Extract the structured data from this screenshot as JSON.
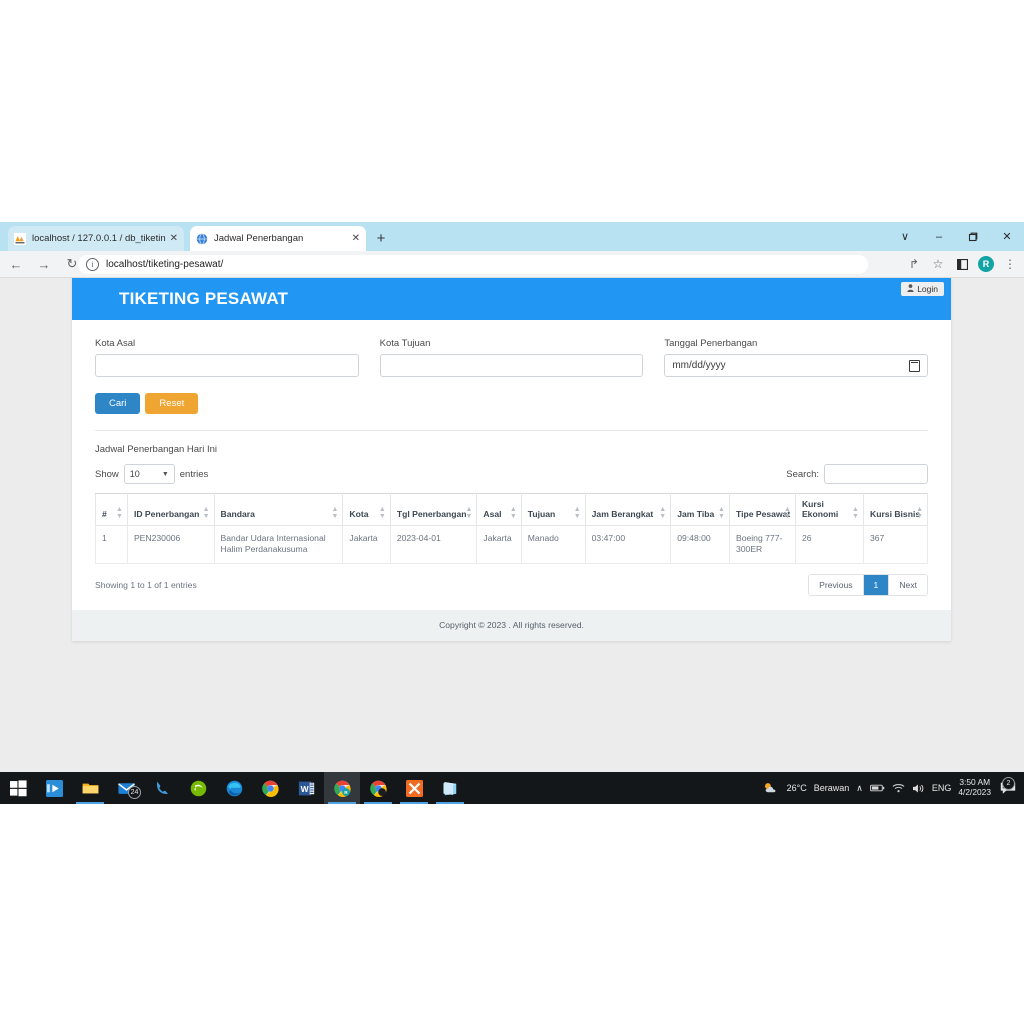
{
  "browser": {
    "tabs": [
      {
        "title": "localhost / 127.0.0.1 / db_tiketing",
        "favicon": "phpmyadmin-icon",
        "close": "✕",
        "active": false
      },
      {
        "title": "Jadwal Penerbangan",
        "favicon": "globe-icon",
        "close": "✕",
        "active": true
      }
    ],
    "new_tab_label": "+",
    "window_controls": {
      "collapse": "∨",
      "minimize": "–",
      "maximize": "❐",
      "close": "✕"
    },
    "nav": {
      "back": "←",
      "forward": "→",
      "reload": "↻"
    },
    "omnibox": {
      "info": "i",
      "url": "localhost/tiketing-pesawat/"
    },
    "toolbar_icons": {
      "share": "↱",
      "bookmark": "☆",
      "sidepanel": "◨",
      "menu": "⋮"
    },
    "profile_initial": "R"
  },
  "site": {
    "brand": "TIKETING PESAWAT",
    "login_label": "Login",
    "login_icon": "user-icon",
    "accent_blue": "#2196f3",
    "button_blue": "#2e86c7",
    "button_orange": "#efa531"
  },
  "search_form": {
    "fields": [
      {
        "label": "Kota Asal",
        "value": "",
        "type": "text"
      },
      {
        "label": "Kota Tujuan",
        "value": "",
        "type": "text"
      },
      {
        "label": "Tanggal Penerbangan",
        "value": "mm/dd/yyyy",
        "type": "date"
      }
    ],
    "submit_label": "Cari",
    "reset_label": "Reset"
  },
  "datatable": {
    "title": "Jadwal Penerbangan Hari Ini",
    "show_label": "Show",
    "entries_label": "entries",
    "page_length": "10",
    "search_label": "Search:",
    "search_value": "",
    "columns": [
      "#",
      "ID Penerbangan",
      "Bandara",
      "Kota",
      "Tgl Penerbangan",
      "Asal",
      "Tujuan",
      "Jam Berangkat",
      "Jam Tiba",
      "Tipe Pesawat",
      "Kursi Ekonomi",
      "Kursi Bisnis"
    ],
    "rows": [
      {
        "no": "1",
        "id_penerbangan": "PEN230006",
        "bandara": "Bandar Udara Internasional Halim Perdanakusuma",
        "kota": "Jakarta",
        "tgl_penerbangan": "2023-04-01",
        "asal": "Jakarta",
        "tujuan": "Manado",
        "jam_berangkat": "03:47:00",
        "jam_tiba": "09:48:00",
        "tipe_pesawat": "Boeing 777-300ER",
        "kursi_ekonomi": "26",
        "kursi_bisnis": "367"
      }
    ],
    "info": "Showing 1 to 1 of 1 entries",
    "pagination": {
      "previous": "Previous",
      "current": "1",
      "next": "Next"
    }
  },
  "footer": {
    "copyright": "Copyright © 2023 . All rights reserved."
  },
  "taskbar": {
    "apps": [
      {
        "name": "start-button"
      },
      {
        "name": "movies-tv-icon"
      },
      {
        "name": "file-explorer-icon"
      },
      {
        "name": "mail-icon",
        "badge": "24"
      },
      {
        "name": "phone-link-icon"
      },
      {
        "name": "nvidia-icon"
      },
      {
        "name": "microsoft-edge-icon"
      },
      {
        "name": "google-chrome-icon"
      },
      {
        "name": "microsoft-word-icon"
      },
      {
        "name": "chrome-window-icon"
      },
      {
        "name": "chrome-window-2-icon"
      },
      {
        "name": "xampp-icon"
      },
      {
        "name": "notepad-icon"
      }
    ],
    "tray": {
      "weather_icon": "partly-cloudy-icon",
      "temperature": "26°C",
      "condition": "Berawan",
      "overflow": "∧",
      "battery_icon": "battery-icon",
      "network_icon": "wifi-icon",
      "volume_icon": "speaker-icon",
      "language": "ENG",
      "time": "3:50 AM",
      "date": "4/2/2023",
      "notification_icon": "action-center-icon",
      "notification_count": "2"
    }
  }
}
